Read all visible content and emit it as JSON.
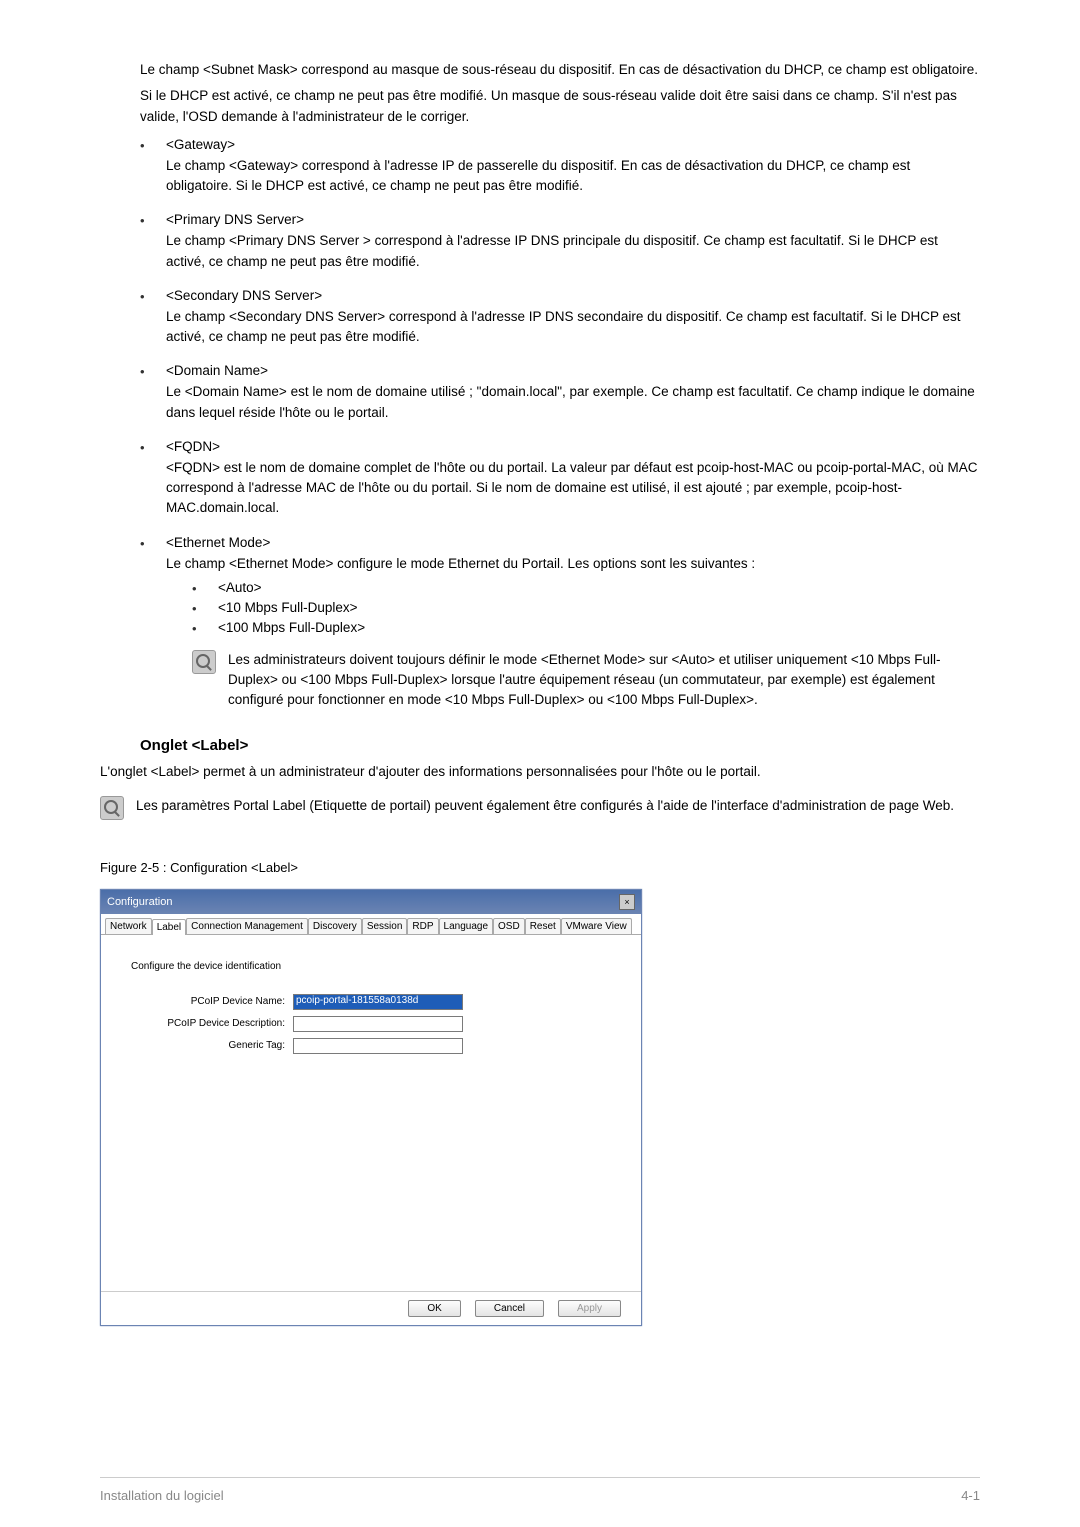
{
  "intro": {
    "p1": "Le champ <Subnet Mask> correspond au masque de sous-réseau du dispositif. En cas de désactivation du DHCP, ce champ est obligatoire.",
    "p2": "Si le DHCP est activé, ce champ ne peut pas être modifié. Un masque de sous-réseau valide doit être saisi dans ce champ. S'il n'est pas valide, l'OSD demande à l'administrateur de le corriger."
  },
  "items": {
    "gateway": {
      "title": "<Gateway>",
      "body": "Le champ <Gateway> correspond à l'adresse IP de passerelle du dispositif. En cas de désactivation du DHCP, ce champ est obligatoire. Si le DHCP est activé, ce champ ne peut pas être modifié."
    },
    "primary_dns": {
      "title": "<Primary DNS Server>",
      "body": "Le champ <Primary DNS Server > correspond à l'adresse IP DNS principale du dispositif. Ce champ est facultatif. Si le DHCP est activé, ce champ ne peut pas être modifié."
    },
    "secondary_dns": {
      "title": "<Secondary DNS Server>",
      "body": "Le champ <Secondary DNS Server> correspond à l'adresse IP DNS secondaire du dispositif. Ce champ est facultatif. Si le DHCP est activé, ce champ ne peut pas être modifié."
    },
    "domain_name": {
      "title": "<Domain Name>",
      "body": "Le <Domain Name> est le nom de domaine utilisé ; \"domain.local\", par exemple. Ce champ est facultatif. Ce champ indique le domaine dans lequel réside l'hôte ou le portail."
    },
    "fqdn": {
      "title": "<FQDN>",
      "body": "<FQDN> est le nom de domaine complet de l'hôte ou du portail. La valeur par défaut est pcoip-host-MAC ou pcoip-portal-MAC, où MAC correspond à l'adresse MAC de l'hôte ou du portail. Si le nom de domaine est utilisé, il est ajouté ; par exemple, pcoip-host-MAC.domain.local."
    },
    "ethernet": {
      "title": "<Ethernet Mode>",
      "body": "Le champ <Ethernet Mode> configure le mode Ethernet du Portail. Les options sont les suivantes :",
      "opts": {
        "o1": "<Auto>",
        "o2": "<10 Mbps Full-Duplex>",
        "o3": "<100 Mbps Full-Duplex>"
      },
      "note": "Les administrateurs doivent toujours définir le mode <Ethernet Mode> sur <Auto> et utiliser uniquement <10 Mbps Full-Duplex> ou <100 Mbps Full-Duplex> lorsque l'autre équipement réseau (un commutateur, par exemple) est également configuré pour fonctionner en mode <10 Mbps Full-Duplex> ou <100 Mbps Full-Duplex>."
    }
  },
  "label_section": {
    "heading": "Onglet <Label>",
    "intro": "L'onglet <Label> permet à un administrateur d'ajouter des informations personnalisées pour l'hôte ou le portail.",
    "note": "Les paramètres Portal Label (Etiquette de portail) peuvent également être configurés à l'aide de l'interface d'administration de page Web.",
    "figure_caption": "Figure 2-5 : Configuration <Label>"
  },
  "dialog": {
    "title": "Configuration",
    "tabs": {
      "network": "Network",
      "label": "Label",
      "conn": "Connection Management",
      "discovery": "Discovery",
      "session": "Session",
      "rdp": "RDP",
      "language": "Language",
      "osd": "OSD",
      "reset": "Reset",
      "vmware": "VMware View"
    },
    "body_desc": "Configure the device identification",
    "fields": {
      "name_lbl": "PCoIP Device Name:",
      "name_val": "pcoip-portal-181558a0138d",
      "desc_lbl": "PCoIP Device Description:",
      "desc_val": "",
      "tag_lbl": "Generic Tag:",
      "tag_val": ""
    },
    "buttons": {
      "ok": "OK",
      "cancel": "Cancel",
      "apply": "Apply"
    }
  },
  "footer": {
    "left": "Installation du logiciel",
    "right": "4-1"
  }
}
